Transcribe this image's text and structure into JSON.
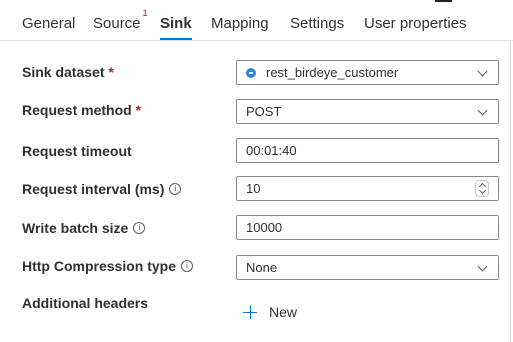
{
  "tabs": [
    {
      "label": "General"
    },
    {
      "label": "Source",
      "badge": "1"
    },
    {
      "label": "Sink",
      "active": true
    },
    {
      "label": "Mapping"
    },
    {
      "label": "Settings"
    },
    {
      "label": "User properties"
    }
  ],
  "required_marker": "*",
  "info_glyph": "i",
  "fields": {
    "sink_dataset": {
      "label": "Sink dataset",
      "value": "rest_birdeye_customer",
      "icon": "dataset-icon"
    },
    "request_method": {
      "label": "Request method",
      "value": "POST"
    },
    "request_timeout": {
      "label": "Request timeout",
      "value": "00:01:40"
    },
    "request_interval": {
      "label": "Request interval (ms)",
      "value": "10"
    },
    "write_batch_size": {
      "label": "Write batch size",
      "value": "10000"
    },
    "http_compression": {
      "label": "Http Compression type",
      "value": "None"
    },
    "additional_headers": {
      "label": "Additional headers",
      "new_label": "New"
    }
  },
  "colors": {
    "accent": "#0078d4",
    "required": "#a4262c",
    "dataset_icon": "#2b88d8"
  }
}
